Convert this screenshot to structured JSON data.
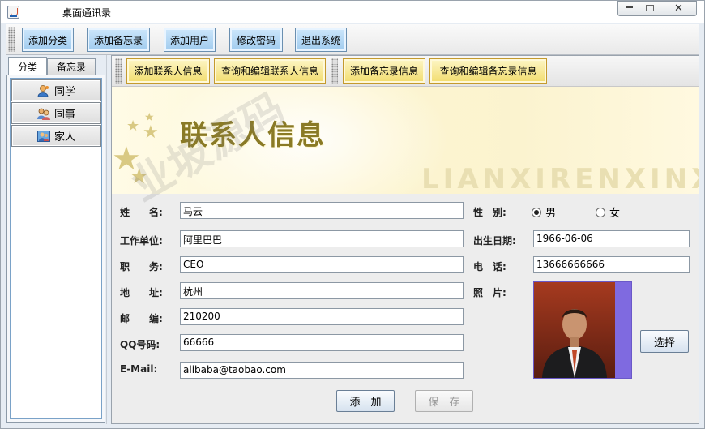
{
  "window": {
    "title": "桌面通讯录"
  },
  "toolbar": {
    "buttons": [
      "添加分类",
      "添加备忘录",
      "添加用户",
      "修改密码",
      "退出系统"
    ]
  },
  "left": {
    "tabs": [
      "分类",
      "备忘录"
    ],
    "categories": [
      {
        "label": "同学",
        "icon": "classmate-icon"
      },
      {
        "label": "同事",
        "icon": "colleague-icon"
      },
      {
        "label": "家人",
        "icon": "family-icon"
      }
    ]
  },
  "subtoolbar": {
    "buttons": [
      "添加联系人信息",
      "查询和编辑联系人信息",
      "添加备忘录信息",
      "查询和编辑备忘录信息"
    ]
  },
  "banner": {
    "title": "联系人信息",
    "pinyin": "LIANXIRENXINXI"
  },
  "form": {
    "name_label": "姓　　名:",
    "name_value": "马云",
    "gender_label": "性　别:",
    "gender_male": "男",
    "gender_female": "女",
    "gender_selected": "男",
    "company_label": "工作单位:",
    "company_value": "阿里巴巴",
    "birthday_label": "出生日期:",
    "birthday_value": "1966-06-06",
    "position_label": "职　　务:",
    "position_value": "CEO",
    "phone_label": "电　话:",
    "phone_value": "13666666666",
    "address_label": "地　　址:",
    "address_value": "杭州",
    "photo_label": "照　片:",
    "zip_label": "邮　　编:",
    "zip_value": "210200",
    "qq_label": "QQ号码:",
    "qq_value": "66666",
    "email_label": "E-Mail:",
    "email_value": "alibaba@taobao.com",
    "select_button": "选择",
    "add_button": "添　加",
    "save_button": "保　存"
  },
  "watermark": "业坡源码",
  "colors": {
    "toolbar_button": "#a9d3f2",
    "subtoolbar_button": "#f5df75",
    "banner_title": "#8a7a25",
    "photo_frame": "#7f6ae0"
  }
}
